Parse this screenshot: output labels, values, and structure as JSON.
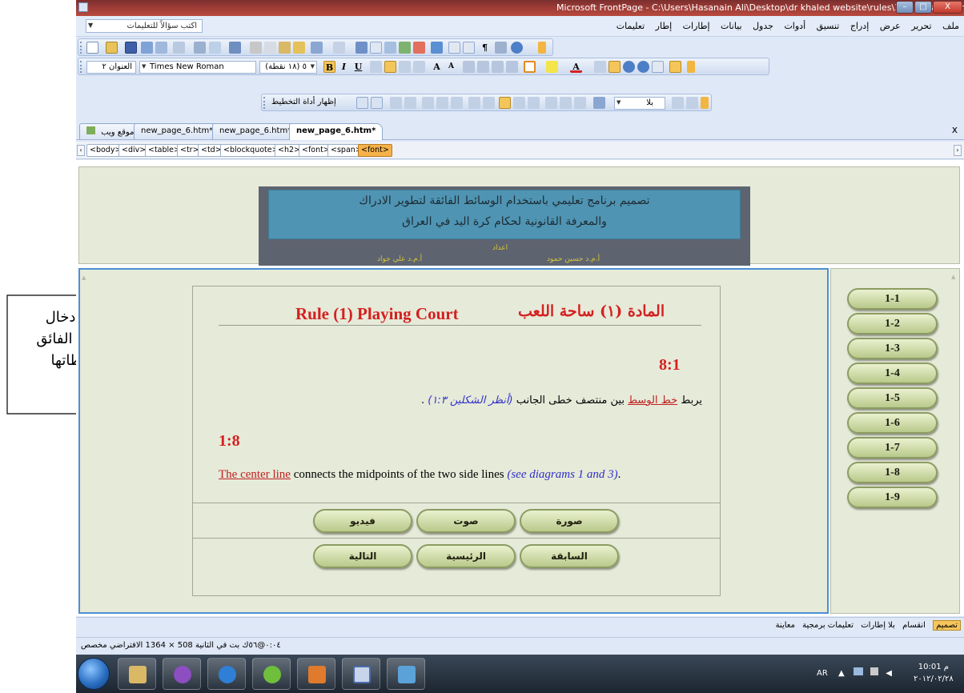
{
  "window": {
    "title": "Microsoft FrontPage - C:\\Users\\Hasanain Ali\\Desktop\\dr khaled website\\rules\\1\\new_page_6.htm",
    "minimize": "–",
    "maximize": "□",
    "close": "X"
  },
  "menu": {
    "items": [
      "ملف",
      "تحرير",
      "عرض",
      "إدراج",
      "تنسيق",
      "أدوات",
      "جدول",
      "بيانات",
      "إطارات",
      "إطار",
      "تعليمات"
    ]
  },
  "ask_box": {
    "placeholder": "اكتب سؤالاً للتعليمات"
  },
  "formatting": {
    "style": "العنوان ٢",
    "font": "Times New Roman",
    "size": "٥ (١٨ نقطة)"
  },
  "layer_toolbar": {
    "show_label": "إظهار أداة التخطيط",
    "combo": "بلا"
  },
  "tabs": [
    {
      "label": "موقع ويب"
    },
    {
      "label": "new_page_6.htm*"
    },
    {
      "label": "new_page_6.htm*"
    },
    {
      "label": "new_page_6.htm*"
    }
  ],
  "tab_close": "x",
  "tag_bar": {
    "tags": [
      "<body>",
      "<div>",
      "<table>",
      "<tr>",
      "<td>",
      "<blockquote>",
      "<h2>",
      "<font>",
      "<span>",
      "<font>"
    ]
  },
  "banner": {
    "line1": "تصميم برنامج تعليمي باستخدام الوسائط الفائقة لتطوير الادراك",
    "line2": "والمعرفة القانونية لحكام كرة اليد في العراق",
    "by": "اعداد",
    "author1": "أ.م.د حسين حمود",
    "author2": "أ.م.د علي جواد"
  },
  "content": {
    "title_en": "Rule (1) Playing Court",
    "title_ar": "المادة (١) ساحة اللعب",
    "num_ar": "8:1",
    "para_ar_pre": "يربط ",
    "para_ar_link": "خط الوسط",
    "para_ar_mid": " بين منتصف خطى الجانب ",
    "para_ar_ref": "(أنظر الشكلين ١:٣)",
    "para_ar_end": " .",
    "num_en": "1:8",
    "para_en_link": "The center line",
    "para_en_mid": " connects the midpoints of the two side lines ",
    "para_en_ref": "(see diagrams 1 and 3)",
    "para_en_end": ".",
    "media_buttons": [
      "صورة",
      "صوت",
      "فيديو"
    ],
    "nav_buttons": [
      "السابقة",
      "الرئيسية",
      "التالية"
    ]
  },
  "side_nav": [
    "1-1",
    "1-2",
    "1-3",
    "1-4",
    "1-5",
    "1-6",
    "1-7",
    "1-8",
    "1-9"
  ],
  "callout": {
    "lines": [
      "عملية ادخال",
      "الوسائط الفائق",
      "وارتباطاتها"
    ]
  },
  "view_tabs": [
    "تصميم",
    "انقسام",
    "بلا إطارات",
    "تعليمات برمجية",
    "معاينة"
  ],
  "status": {
    "text": "٠:٠٤@٥٦ك بت في الثانية   508 × 1364   الافتراضي   مخصص"
  },
  "taskbar": {
    "lang": "AR",
    "time": "10:01 م",
    "date": "٢٠١٢/٠٢/٢٨"
  },
  "colors": {
    "accent_red": "#d42020",
    "link_blue": "#3030c8",
    "page_bg": "#e6ead9",
    "selection_border": "#4b8fd6"
  }
}
